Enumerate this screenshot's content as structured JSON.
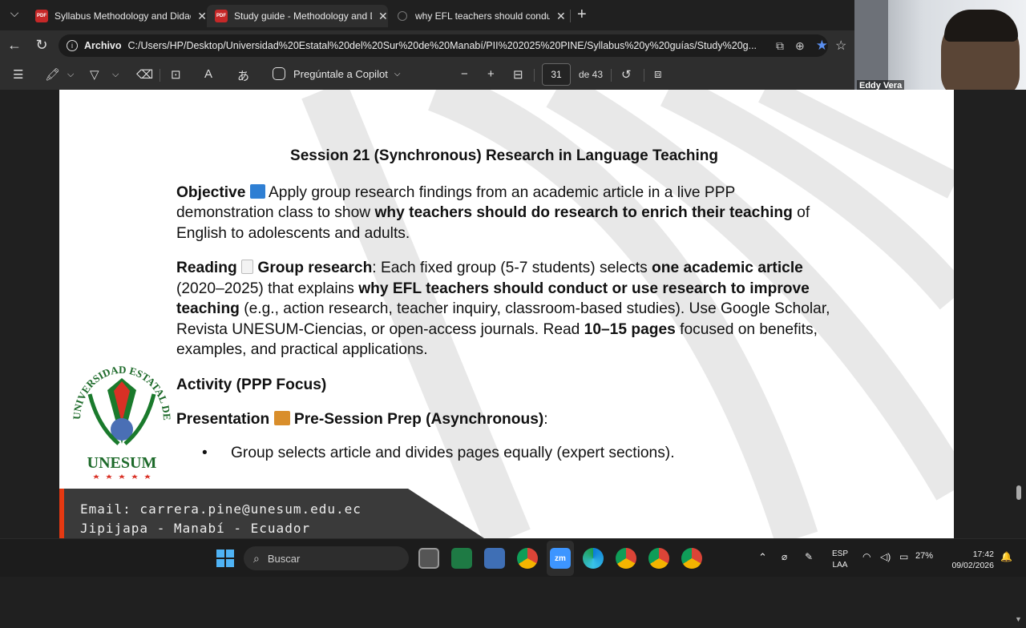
{
  "tabs": [
    {
      "title": "Syllabus Methodology and Didacti",
      "icon": "pdf-icon"
    },
    {
      "title": "Study guide - Methodology and D",
      "icon": "pdf-icon",
      "active": true
    },
    {
      "title": "why EFL teachers should conduct o",
      "icon": "globe-icon"
    }
  ],
  "addressbar": {
    "scheme": "Archivo",
    "url": "C:/Users/HP/Desktop/Universidad%20Estatal%20del%20Sur%20de%20Manabí/PII%202025%20PINE/Syllabus%20y%20guías/Study%20g..."
  },
  "pdf_toolbar": {
    "copilot_label": "Pregúntale a Copilot",
    "page_number": "31",
    "page_total": "de 43",
    "pdf_badge": "PDF"
  },
  "webcam": {
    "participant_name": "Eddy Vera"
  },
  "document": {
    "session_title": "Session 21 (Synchronous) Research in Language Teaching",
    "objective": {
      "label": "Objective",
      "t1": " Apply group research findings from an academic article in a live PPP demonstration class to show ",
      "b1": "why teachers should do research to enrich their teaching",
      "t2": " of English to adolescents and adults."
    },
    "reading": {
      "label": "Reading",
      "b0": "Group research",
      "t0": ": Each fixed group (5-7 students) selects ",
      "b1": "one academic article",
      "t1": " (2020–2025) that explains ",
      "b2": "why EFL teachers should conduct or use research to improve teaching",
      "t2": " (e.g., action research, teacher inquiry, classroom-based studies). Use Google Scholar, Revista UNESUM-Ciencias, or open-access journals. Read ",
      "b3": "10–15 pages",
      "t3": " focused on benefits, examples, and practical applications."
    },
    "activity_heading": "Activity (PPP Focus)",
    "presentation": {
      "label": "Presentation",
      "b0": "Pre-Session Prep (Asynchronous)",
      "t0": ":"
    },
    "bullet": "Group selects article and divides pages equally (expert sections).",
    "logo_text": "UNIVERSIDAD ESTATAL DEL SUR DE MANABÍ",
    "logo_name": "UNESUM",
    "footer_email": "Email: carrera.pine@unesum.edu.ec",
    "footer_location": "Jipijapa - Manabí - Ecuador"
  },
  "taskbar": {
    "search_placeholder": "Buscar",
    "lang_top": "ESP",
    "lang_bottom": "LAA",
    "battery": "27%",
    "time": "17:42",
    "date": "09/02/2026",
    "zoom_label": "zm"
  }
}
